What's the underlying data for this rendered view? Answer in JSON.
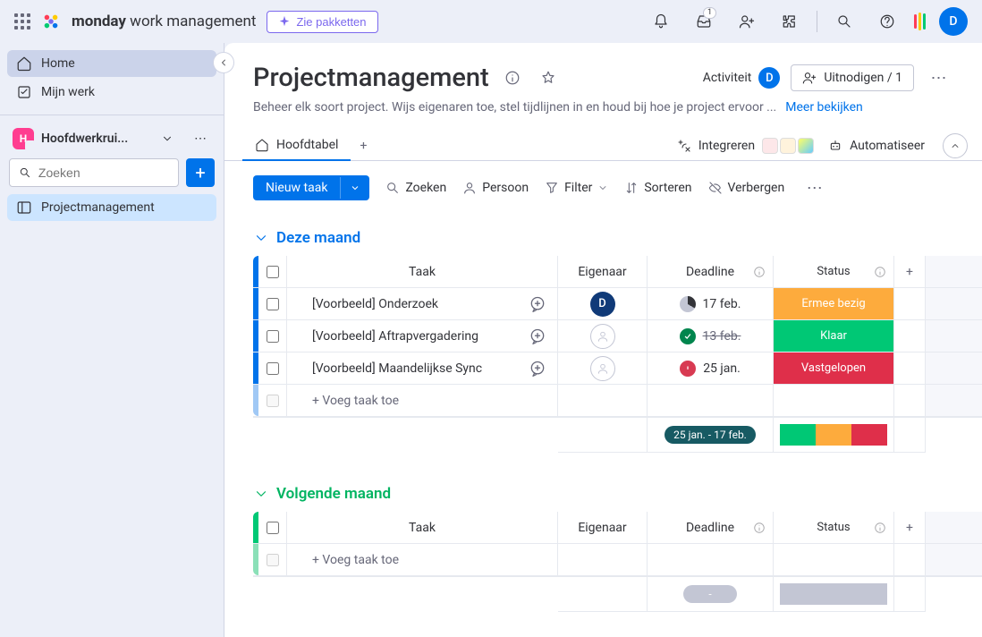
{
  "header": {
    "brand": "monday",
    "brand_suffix": " work management",
    "plans_label": "Zie pakketten",
    "inbox_badge": "1",
    "avatar_initial": "D"
  },
  "sidebar": {
    "home_label": "Home",
    "mywork_label": "Mijn werk",
    "workspace_name": "Hoofdwerkrui...",
    "search_placeholder": "Zoeken",
    "board_label": "Projectmanagement"
  },
  "board": {
    "title": "Projectmanagement",
    "description": "Beheer elk soort project. Wijs eigenaren toe, stel tijdlijnen in en houd bij hoe je project ervoor ...",
    "more_link": "Meer bekijken",
    "activity_label": "Activiteit",
    "invite_label": "Uitnodigen / 1"
  },
  "tabs": {
    "main_tab": "Hoofdtabel",
    "integrate_label": "Integreren",
    "automate_label": "Automatiseer"
  },
  "toolbar": {
    "new_task": "Nieuw taak",
    "search": "Zoeken",
    "person": "Persoon",
    "filter": "Filter",
    "sort": "Sorteren",
    "hide": "Verbergen"
  },
  "columns": {
    "task": "Taak",
    "owner": "Eigenaar",
    "deadline": "Deadline",
    "status": "Status"
  },
  "groups": [
    {
      "name": "Deze maand",
      "tasks": [
        {
          "name": "[Voorbeeld] Onderzoek",
          "owner": "D",
          "date": "17 feb.",
          "date_state": "progress",
          "status": "Ermee bezig",
          "status_class": "status-working"
        },
        {
          "name": "[Voorbeeld] Aftrapvergadering",
          "owner": "",
          "date": "13 feb.",
          "date_state": "done",
          "status": "Klaar",
          "status_class": "status-done"
        },
        {
          "name": "[Voorbeeld] Maandelijkse Sync",
          "owner": "",
          "date": "25 jan.",
          "date_state": "stuck",
          "status": "Vastgelopen",
          "status_class": "status-stuck"
        }
      ],
      "add_label": "+ Voeg taak toe",
      "summary_range": "25 jan. - 17 feb."
    },
    {
      "name": "Volgende maand",
      "tasks": [],
      "add_label": "+ Voeg taak toe",
      "summary_range": "-"
    }
  ]
}
